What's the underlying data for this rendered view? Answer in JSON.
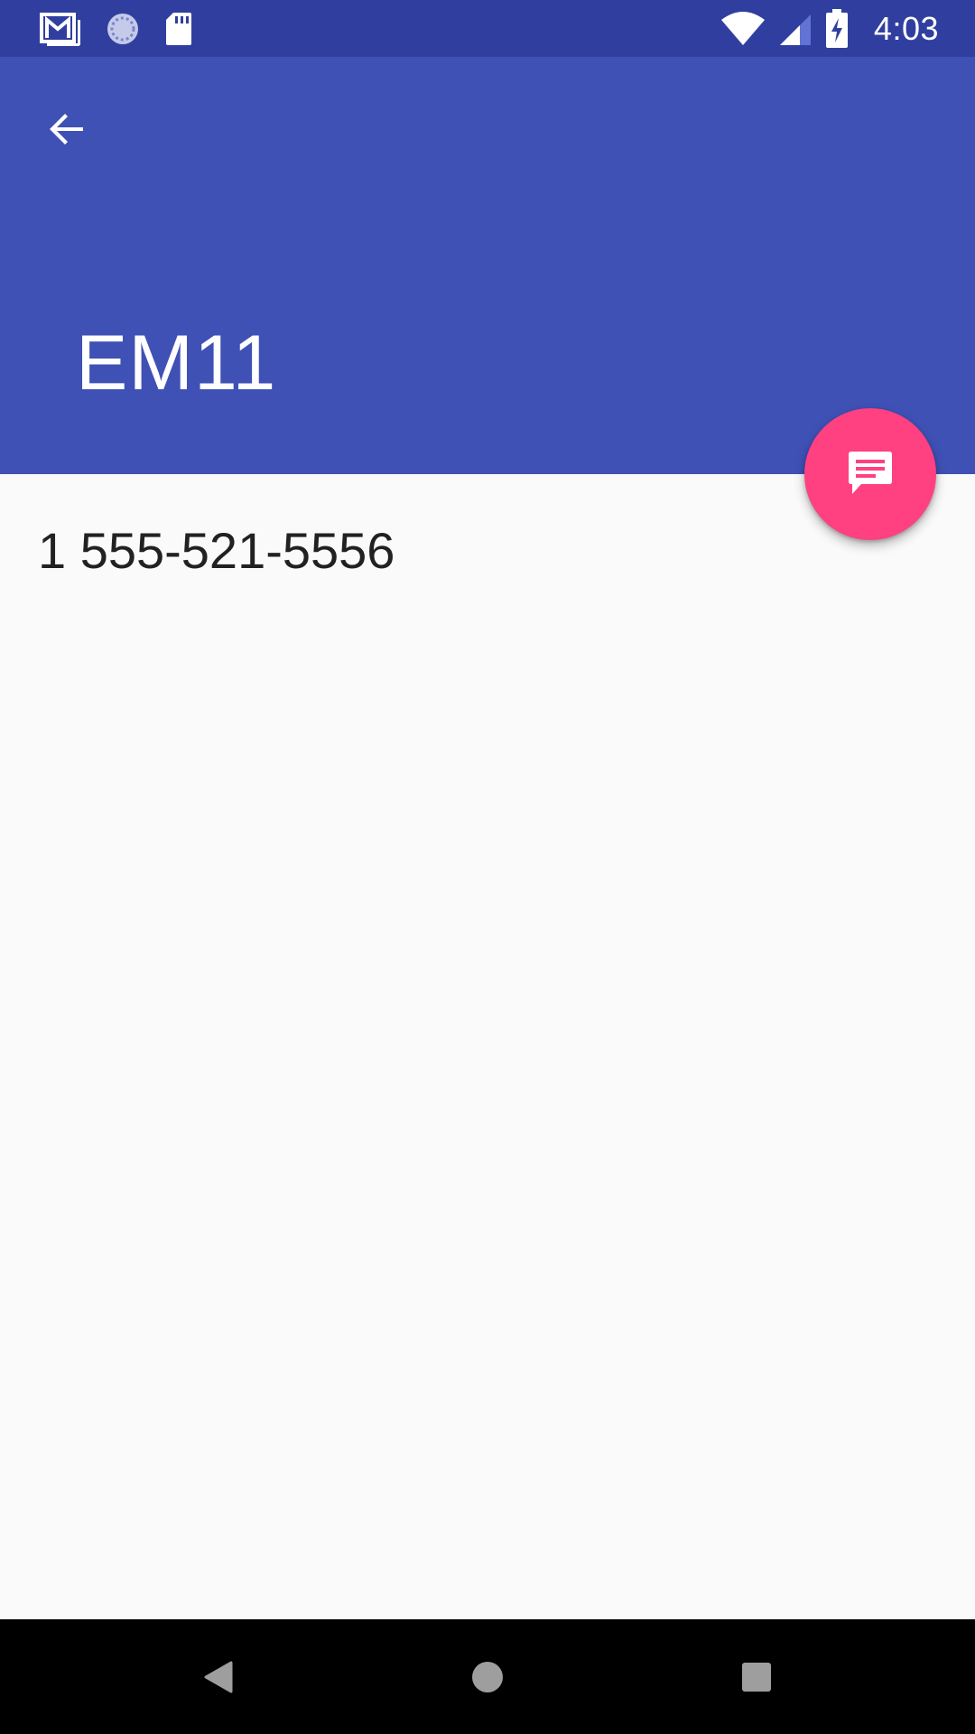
{
  "status_bar": {
    "time": "4:03",
    "icons_left": [
      "gmail-icon",
      "sync-icon",
      "sd-card-icon"
    ],
    "icons_right": [
      "wifi-icon",
      "cell-signal-icon",
      "battery-charging-icon"
    ]
  },
  "app_bar": {
    "title": "EM11",
    "back_icon": "arrow-back-icon",
    "color": "#3f51b5"
  },
  "fab": {
    "icon": "message-icon",
    "color": "#ff4081"
  },
  "content": {
    "phone_number": "1 555-521-5556"
  },
  "nav_bar": {
    "buttons": [
      "back-triangle-icon",
      "home-circle-icon",
      "recents-square-icon"
    ]
  },
  "colors": {
    "status_bar": "#303f9f",
    "background": "#fafafa",
    "text": "#212121"
  }
}
